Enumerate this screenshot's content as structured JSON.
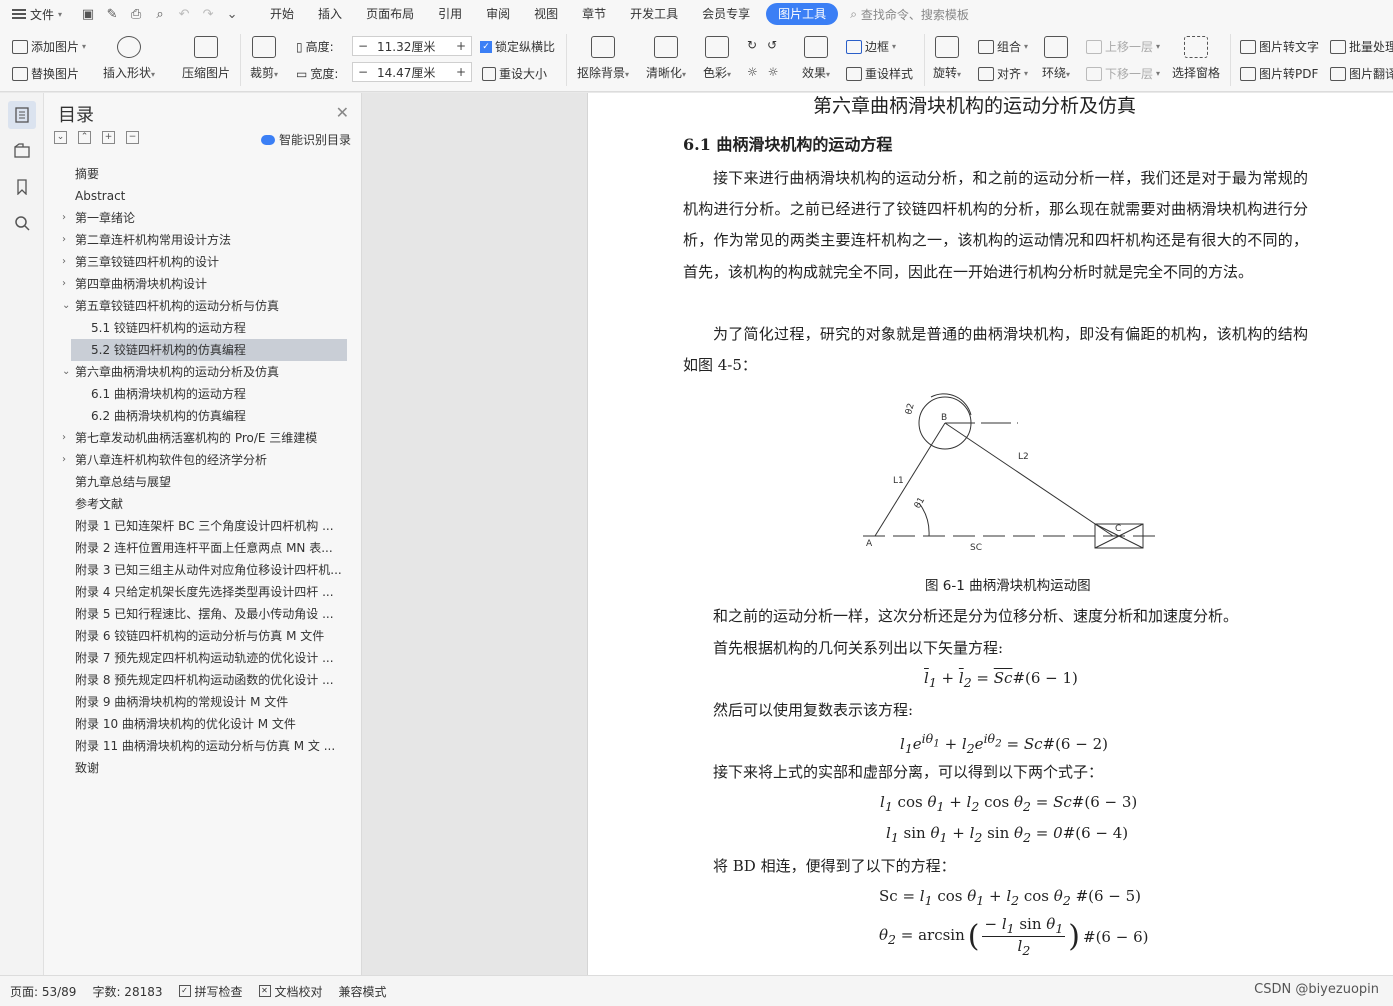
{
  "menubar": {
    "file_label": "文件",
    "tabs": [
      "开始",
      "插入",
      "页面布局",
      "引用",
      "审阅",
      "视图",
      "章节",
      "开发工具",
      "会员专享"
    ],
    "active_tab": "图片工具",
    "search_placeholder": "查找命令、搜索模板"
  },
  "ribbon": {
    "add_image": "添加图片",
    "replace_image": "替换图片",
    "insert_shape": "插入形状",
    "compress_image": "压缩图片",
    "crop": "裁剪",
    "height_label": "高度:",
    "height_value": "11.32厘米",
    "width_label": "宽度:",
    "width_value": "14.47厘米",
    "lock_ratio": "锁定纵横比",
    "reset_size": "重设大小",
    "remove_bg": "抠除背景",
    "sharpen": "清晰化",
    "color": "色彩",
    "effects": "效果",
    "border": "边框",
    "reset_style": "重设样式",
    "rotate": "旋转",
    "group": "组合",
    "align": "对齐",
    "wrap": "环绕",
    "bring_forward": "上移一层",
    "send_backward": "下移一层",
    "select_pane": "选择窗格",
    "to_text": "图片转文字",
    "to_pdf": "图片转PDF",
    "batch": "批量处理",
    "translate": "图片翻译"
  },
  "toc": {
    "title": "目录",
    "smart": "智能识别目录",
    "items": [
      {
        "label": "摘要",
        "level": 1,
        "arrow": ""
      },
      {
        "label": "Abstract",
        "level": 1,
        "arrow": ""
      },
      {
        "label": "第一章绪论",
        "level": 1,
        "arrow": "›"
      },
      {
        "label": "第二章连杆机构常用设计方法",
        "level": 1,
        "arrow": "›"
      },
      {
        "label": "第三章铰链四杆机构的设计",
        "level": 1,
        "arrow": "›"
      },
      {
        "label": "第四章曲柄滑块机构设计",
        "level": 1,
        "arrow": "›"
      },
      {
        "label": "第五章铰链四杆机构的运动分析与仿真",
        "level": 1,
        "arrow": "⌄"
      },
      {
        "label": "5.1  铰链四杆机构的运动方程",
        "level": 2,
        "arrow": ""
      },
      {
        "label": "5.2 铰链四杆机构的仿真编程",
        "level": 2,
        "arrow": "",
        "selected": true
      },
      {
        "label": "第六章曲柄滑块机构的运动分析及仿真",
        "level": 1,
        "arrow": "⌄"
      },
      {
        "label": "6.1  曲柄滑块机构的运动方程",
        "level": 2,
        "arrow": ""
      },
      {
        "label": "6.2 曲柄滑块机构的仿真编程",
        "level": 2,
        "arrow": ""
      },
      {
        "label": "第七章发动机曲柄活塞机构的 Pro/E 三维建模",
        "level": 1,
        "arrow": "›"
      },
      {
        "label": "第八章连杆机构软件包的经济学分析",
        "level": 1,
        "arrow": "›"
      },
      {
        "label": "第九章总结与展望",
        "level": 1,
        "arrow": ""
      },
      {
        "label": "参考文献",
        "level": 1,
        "arrow": ""
      },
      {
        "label": "附录 1 已知连架杆 BC 三个角度设计四杆机构 ...",
        "level": 1,
        "arrow": ""
      },
      {
        "label": "附录 2  连杆位置用连杆平面上任意两点 MN 表...",
        "level": 1,
        "arrow": ""
      },
      {
        "label": "附录 3 已知三组主从动件对应角位移设计四杆机...",
        "level": 1,
        "arrow": ""
      },
      {
        "label": "附录 4  只给定机架长度先选择类型再设计四杆 ...",
        "level": 1,
        "arrow": ""
      },
      {
        "label": "附录 5  已知行程速比、摆角、及最小传动角设 ...",
        "level": 1,
        "arrow": ""
      },
      {
        "label": "附录 6  铰链四杆机构的运动分析与仿真 M 文件",
        "level": 1,
        "arrow": ""
      },
      {
        "label": "附录 7  预先规定四杆机构运动轨迹的优化设计 ...",
        "level": 1,
        "arrow": ""
      },
      {
        "label": "附录 8  预先规定四杆机构运动函数的优化设计 ...",
        "level": 1,
        "arrow": ""
      },
      {
        "label": "附录 9  曲柄滑块机构的常规设计 M 文件",
        "level": 1,
        "arrow": ""
      },
      {
        "label": "附录 10  曲柄滑块机构的优化设计 M 文件",
        "level": 1,
        "arrow": ""
      },
      {
        "label": "附录 11  曲柄滑块机构的运动分析与仿真 M 文 ...",
        "level": 1,
        "arrow": ""
      },
      {
        "label": "致谢",
        "level": 1,
        "arrow": ""
      }
    ]
  },
  "doc": {
    "chapter_title": "第六章曲柄滑块机构的运动分析及仿真",
    "section_title": "6.1  曲柄滑块机构的运动方程",
    "para1": "接下来进行曲柄滑块机构的运动分析，和之前的运动分析一样，我们还是对于最为常规的机构进行分析。之前已经进行了铰链四杆机构的分析，那么现在就需要对曲柄滑块机构进行分析，作为常见的两类主要连杆机构之一，该机构的运动情况和四杆机构还是有很大的不同的，首先，该机构的构成就完全不同，因此在一开始进行机构分析时就是完全不同的方法。",
    "para2": "为了简化过程，研究的对象就是普通的曲柄滑块机构，即没有偏距的机构，该机构的结构如图 4-5：",
    "figure": {
      "B": "B",
      "C": "C",
      "A": "A",
      "L1": "L1",
      "L2": "L2",
      "SC": "SC",
      "theta1": "θ1",
      "theta2": "θ2"
    },
    "caption": "图 6-1 曲柄滑块机构运动图",
    "line1": "和之前的运动分析一样，这次分析还是分为位移分析、速度分析和加速度分析。",
    "line2": "首先根据机构的几何关系列出以下矢量方程:",
    "line3": "然后可以使用复数表示该方程:",
    "line4": "接下来将上式的实部和虚部分离，可以得到以下两个式子：",
    "line5": "将 BD 相连，便得到了以下的方程：",
    "eq1_tag": "#(6 − 1)",
    "eq2_tag": "#(6 − 2)",
    "eq3_tag": "#(6 − 3)",
    "eq4_tag": "#(6 − 4)",
    "eq5_tag": "#(6 − 5)",
    "eq6_tag": "#(6 − 6)"
  },
  "status": {
    "page": "页面: 53/89",
    "words": "字数: 28183",
    "spell": "拼写检查",
    "proof": "文档校对",
    "compat": "兼容模式",
    "watermark": "CSDN @biyezuopin"
  }
}
